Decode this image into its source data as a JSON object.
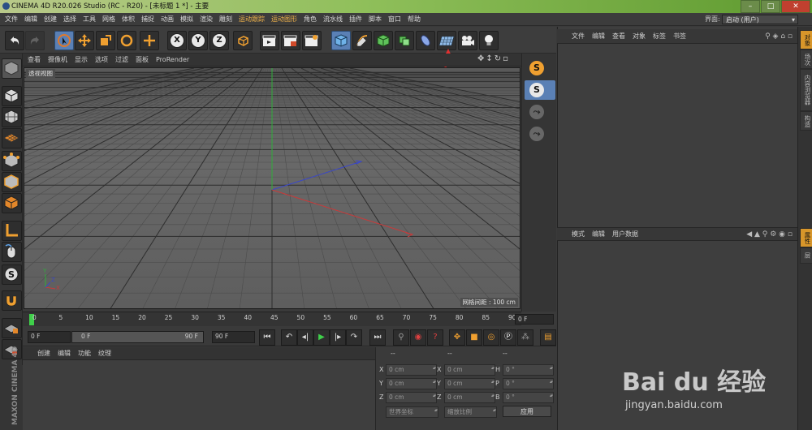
{
  "window": {
    "title": "CINEMA 4D R20.026 Studio (RC - R20) - [未标题 1 *] - 主要"
  },
  "menubar": {
    "items": [
      "文件",
      "编辑",
      "创建",
      "选择",
      "工具",
      "网格",
      "体积",
      "捕捉",
      "动画",
      "模拟",
      "渲染",
      "雕刻",
      "运动跟踪",
      "运动图形",
      "角色",
      "流水线",
      "插件",
      "脚本",
      "窗口",
      "帮助"
    ]
  },
  "layout": {
    "label": "界面:",
    "value": "启动 (用户)"
  },
  "toolbar": {
    "axis_buttons": [
      "X",
      "Y",
      "Z"
    ]
  },
  "viewport": {
    "menu": [
      "查看",
      "摄像机",
      "显示",
      "选项",
      "过滤",
      "面板",
      "ProRender"
    ],
    "view_label": "透视视图",
    "grid_info": "网格间距 : 100 cm"
  },
  "timeline": {
    "ticks": [
      "0",
      "5",
      "10",
      "15",
      "20",
      "25",
      "30",
      "35",
      "40",
      "45",
      "50",
      "55",
      "60",
      "65",
      "70",
      "75",
      "80",
      "85",
      "90"
    ],
    "current_frame": "0 F"
  },
  "playback": {
    "start": "0 F",
    "range_start": "0 F",
    "range_end": "90 F",
    "end": "90 F"
  },
  "material_panel": {
    "menu": [
      "创建",
      "编辑",
      "功能",
      "纹理"
    ]
  },
  "coords": {
    "headers": [
      "--",
      "--",
      "--"
    ],
    "rows": [
      {
        "a": "X",
        "av": "0 cm",
        "b": "X",
        "bv": "0 cm",
        "c": "H",
        "cv": "0 °"
      },
      {
        "a": "Y",
        "av": "0 cm",
        "b": "Y",
        "bv": "0 cm",
        "c": "P",
        "cv": "0 °"
      },
      {
        "a": "Z",
        "av": "0 cm",
        "b": "Z",
        "bv": "0 cm",
        "c": "B",
        "cv": "0 °"
      }
    ],
    "world_select": "世界坐标",
    "scale_select": "缩放比例",
    "apply": "应用"
  },
  "object_panel": {
    "menu": [
      "文件",
      "编辑",
      "查看",
      "对象",
      "标签",
      "书签"
    ]
  },
  "attribute_panel": {
    "menu": [
      "模式",
      "编辑",
      "用户数据"
    ]
  },
  "side_tabs": [
    "对象",
    "场次",
    "内容浏览器",
    "构造",
    "属性",
    "层"
  ],
  "brand": "MAXON CINEMA 4D",
  "watermark": {
    "logo": "Bai du 经验",
    "url": "jingyan.baidu.com"
  },
  "colors": {
    "accent": "#f0a030",
    "selected_tool": "#5a80b5",
    "annotation_arrow": "#e03030"
  }
}
